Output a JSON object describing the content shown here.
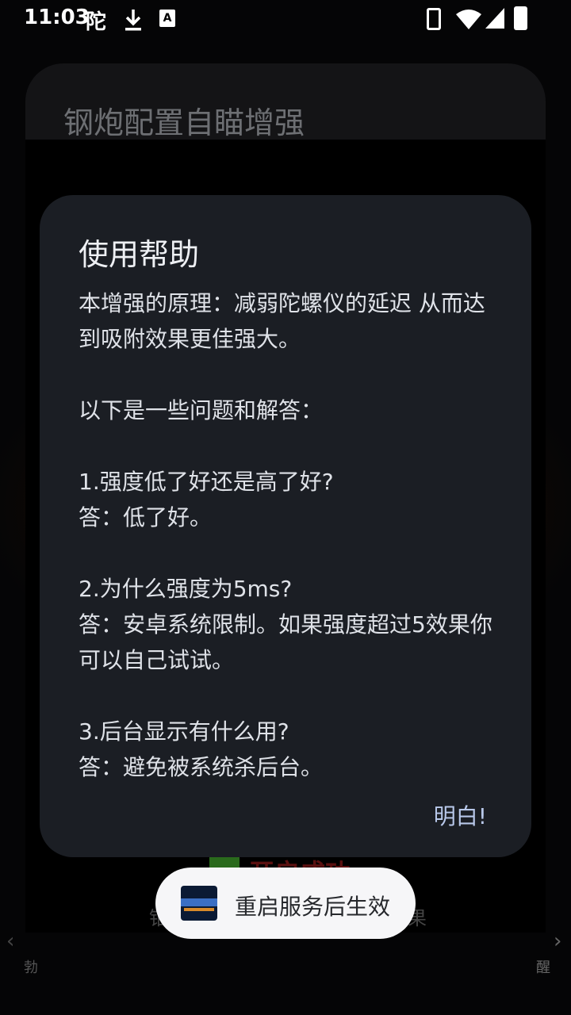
{
  "status_bar": {
    "time": "11:03",
    "carrier_glyph": "陀",
    "icons": [
      "download-icon",
      "a-badge-icon",
      "phone-icon",
      "wifi-icon",
      "signal-icon",
      "battery-charging-icon"
    ],
    "a_badge": "A"
  },
  "background": {
    "app_title": "钢炮配置自瞄增强",
    "status_text": "开启成功",
    "under_toast_left": "铂",
    "under_toast_right": "果",
    "edge_left": "勃",
    "edge_right": "醒",
    "arrow_left": "‹",
    "arrow_right": "›"
  },
  "dialog": {
    "title": "使用帮助",
    "lines": [
      "本增强的原理：减弱陀螺仪的延迟 从而达到吸附效果更佳强大。",
      "",
      "以下是一些问题和解答：",
      "",
      "1.强度低了好还是高了好?",
      "答：低了好。",
      "",
      "2.为什么强度为5ms?",
      "答：安卓系统限制。如果强度超过5效果你可以自己试试。",
      "",
      "3.后台显示有什么用?",
      "答：避免被系统杀后台。"
    ],
    "button_label": "明白!"
  },
  "toast": {
    "text": "重启服务后生效",
    "icon": "app-logo-icon"
  }
}
